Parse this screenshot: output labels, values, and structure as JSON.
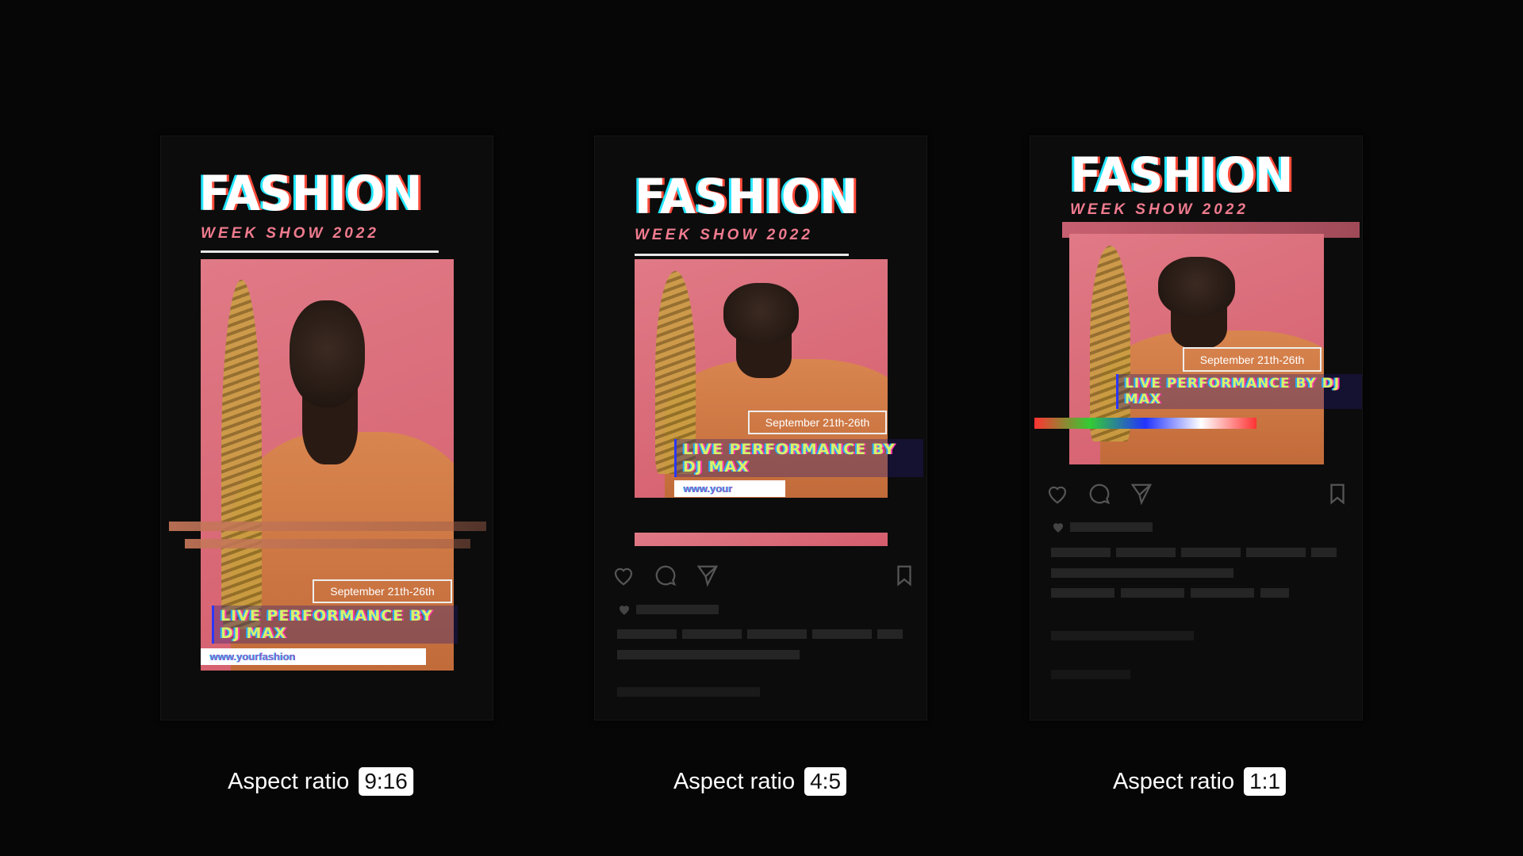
{
  "cards": [
    {
      "aspect": "9:16",
      "title": "FASHION",
      "subtitle": "WEEK SHOW 2022",
      "date": "September 21th-26th",
      "performance": "LIVE PERFORMANCE BY DJ MAX",
      "url": "www.yourfashion"
    },
    {
      "aspect": "4:5",
      "title": "FASHION",
      "subtitle": "WEEK SHOW 2022",
      "date": "September 21th-26th",
      "performance": "LIVE PERFORMANCE BY DJ MAX",
      "url": "www.your"
    },
    {
      "aspect": "1:1",
      "title": "FASHION",
      "subtitle": "WEEK SHOW 2022",
      "date": "September 21th-26th",
      "performance": "LIVE PERFORMANCE BY DJ MAX"
    }
  ],
  "label_prefix": "Aspect ratio",
  "icons": [
    "heart-icon",
    "comment-icon",
    "share-icon",
    "bookmark-icon"
  ],
  "colors": {
    "background": "#060606",
    "accent_pink": "#f07b8f",
    "photo_pink": "#e07a86"
  }
}
